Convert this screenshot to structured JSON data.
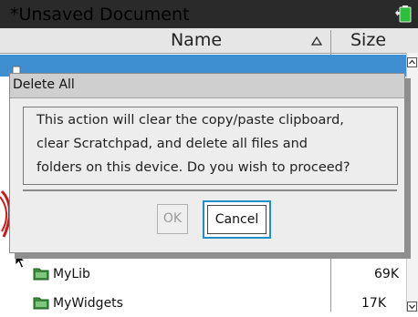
{
  "window": {
    "title": "*Unsaved Document"
  },
  "browser": {
    "columns": {
      "name": "Name",
      "size": "Size"
    },
    "rows": [
      {
        "name": "MyLib",
        "size": "69K"
      },
      {
        "name": "MyWidgets",
        "size": "17K"
      }
    ]
  },
  "dialog": {
    "title": "Delete All",
    "message_lines": [
      "This action will clear the copy/paste clipboard,",
      "clear Scratchpad, and delete all files and",
      "folders on this device. Do you wish to proceed?"
    ],
    "ok_label": "OK",
    "cancel_label": "Cancel"
  },
  "colors": {
    "title_bar": "#2a2a2a",
    "selection": "#3d8fd1",
    "focus_border": "#1e90c8",
    "folder_icon": "#3a8a3a"
  },
  "icons": {
    "battery": "battery-icon",
    "sort": "sort-ascending-icon",
    "folder": "folder-icon",
    "scroll_up": "scroll-up-arrow-icon",
    "scroll_down": "scroll-down-arrow-icon",
    "pointer": "mouse-pointer-icon"
  }
}
